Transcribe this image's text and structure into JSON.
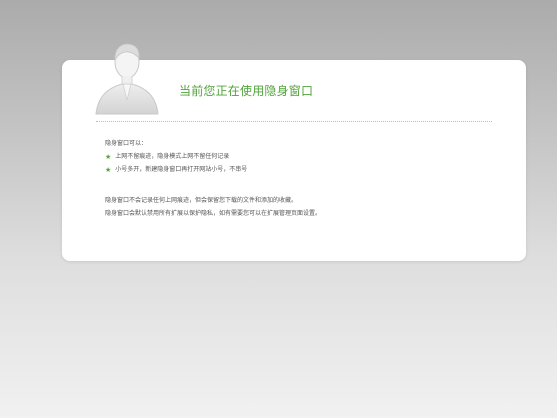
{
  "title": "当前您正在使用隐身窗口",
  "intro": "隐身窗口可以：",
  "features": [
    "上网不留痕迹，隐身模式上网不留任何记录",
    "小号多开，新建隐身窗口再打开网站小号，不串号"
  ],
  "notes": [
    "隐身窗口不会记录任何上网痕迹，但会保留您下载的文件和添加的收藏。",
    "隐身窗口会默认禁用所有扩展以保护隐私，如有需要您可以在扩展管理页面设置。"
  ],
  "icons": {
    "avatar": "incognito-person-icon",
    "bullet": "star-icon"
  },
  "colors": {
    "accent": "#52a33c",
    "text": "#555555",
    "card": "#ffffff"
  }
}
